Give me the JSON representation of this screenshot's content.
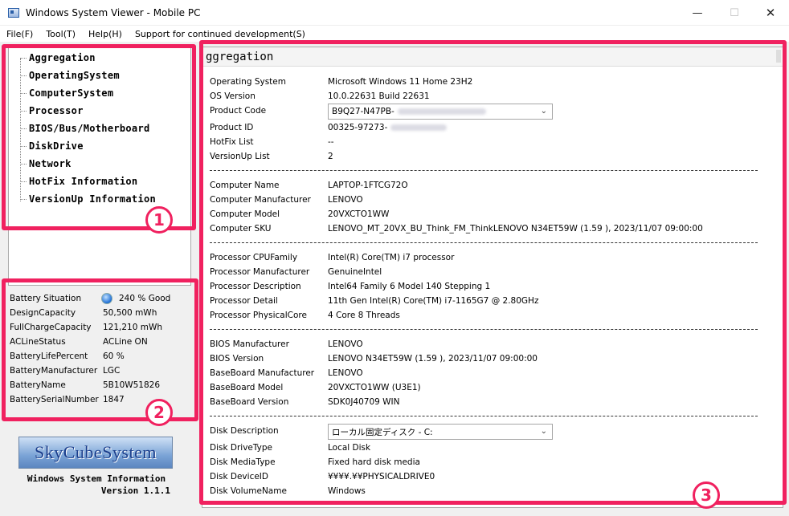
{
  "window": {
    "title": "Windows System Viewer - Mobile PC",
    "minimize": "—",
    "maximize": "☐",
    "close": "✕"
  },
  "menu": [
    "File(F)",
    "Tool(T)",
    "Help(H)",
    "Support for continued development(S)"
  ],
  "tree": [
    "Aggregation",
    "OperatingSystem",
    "ComputerSystem",
    "Processor",
    "BIOS/Bus/Motherboard",
    "DiskDrive",
    "Network",
    "HotFix Information",
    "VersionUp Information"
  ],
  "battery": [
    {
      "label": "Battery Situation",
      "value": "240 % Good"
    },
    {
      "label": "DesignCapacity",
      "value": "50,500 mWh"
    },
    {
      "label": "FullChargeCapacity",
      "value": "121,210 mWh"
    },
    {
      "label": "ACLineStatus",
      "value": "ACLine ON"
    },
    {
      "label": "BatteryLifePercent",
      "value": "60 %"
    },
    {
      "label": "BatteryManufacturer",
      "value": "LGC"
    },
    {
      "label": "BatteryName",
      "value": "5B10W51826"
    },
    {
      "label": "BatterySerialNumber",
      "value": "1847"
    }
  ],
  "logo": "SkyCubeSystem",
  "app_info": {
    "line1": "Windows System Information",
    "line2": "Version 1.1.1"
  },
  "detail": {
    "heading": "ggregation",
    "os": [
      {
        "label": "Operating System",
        "value": "Microsoft Windows 11 Home 23H2"
      },
      {
        "label": "OS Version",
        "value": "10.0.22631 Build 22631"
      },
      {
        "label": "Product Code",
        "value": "B9Q27-N47PB-"
      },
      {
        "label": "Product ID",
        "value": "00325-97273-"
      },
      {
        "label": "HotFix List",
        "value": "--"
      },
      {
        "label": "VersionUp List",
        "value": "2"
      }
    ],
    "computer": [
      {
        "label": "Computer Name",
        "value": "LAPTOP-1FTCG72O"
      },
      {
        "label": "Computer Manufacturer",
        "value": "LENOVO"
      },
      {
        "label": "Computer Model",
        "value": "20VXCTO1WW"
      },
      {
        "label": "Computer SKU",
        "value": "LENOVO_MT_20VX_BU_Think_FM_ThinkLENOVO N34ET59W (1.59 ), 2023/11/07 09:00:00"
      }
    ],
    "processor": [
      {
        "label": "Processor CPUFamily",
        "value": "Intel(R) Core(TM) i7 processor"
      },
      {
        "label": "Processor Manufacturer",
        "value": "GenuineIntel"
      },
      {
        "label": "Processor Description",
        "value": "Intel64 Family 6 Model 140 Stepping 1"
      },
      {
        "label": "Processor Detail",
        "value": "11th Gen Intel(R) Core(TM) i7-1165G7 @ 2.80GHz"
      },
      {
        "label": "Processor PhysicalCore",
        "value": "4 Core 8 Threads"
      }
    ],
    "bios": [
      {
        "label": "BIOS Manufacturer",
        "value": "LENOVO"
      },
      {
        "label": "BIOS Version",
        "value": "LENOVO N34ET59W (1.59 ), 2023/11/07 09:00:00"
      },
      {
        "label": "BaseBoard Manufacturer",
        "value": "LENOVO"
      },
      {
        "label": "BaseBoard Model",
        "value": "20VXCTO1WW (U3E1)"
      },
      {
        "label": "BaseBoard Version",
        "value": "SDK0J40709 WIN"
      }
    ],
    "disk": [
      {
        "label": "Disk Description",
        "value": "ローカル固定ディスク - C:"
      },
      {
        "label": "Disk DriveType",
        "value": "Local Disk"
      },
      {
        "label": "Disk MediaType",
        "value": "Fixed hard disk media"
      },
      {
        "label": "Disk DeviceID",
        "value": "¥¥¥¥.¥¥PHYSICALDRIVE0"
      },
      {
        "label": "Disk VolumeName",
        "value": "Windows"
      }
    ]
  },
  "annotations": {
    "badge1": "1",
    "badge2": "2",
    "badge3": "3"
  },
  "colors": {
    "highlight": "#f0215f",
    "logo_text": "#1a3e8c"
  }
}
